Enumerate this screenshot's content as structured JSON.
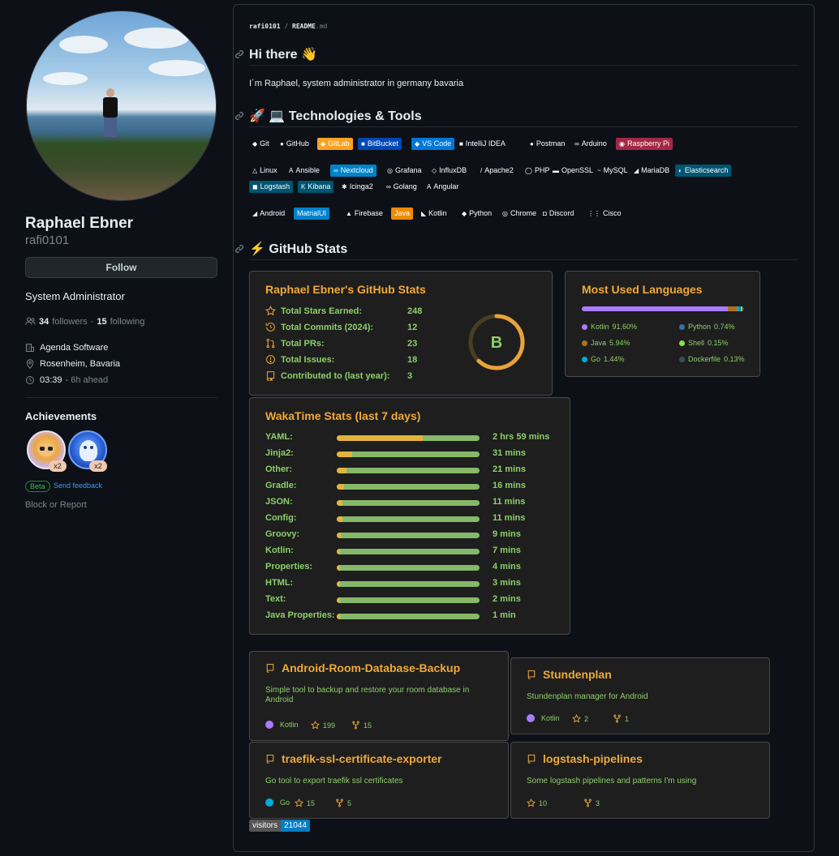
{
  "profile": {
    "name": "Raphael Ebner",
    "login": "rafi0101",
    "follow_label": "Follow",
    "bio": "System Administrator",
    "followers_count": "34",
    "followers_label": "followers",
    "separator": "·",
    "following_count": "15",
    "following_label": "following",
    "company": "Agenda Software",
    "location": "Rosenheim, Bavaria",
    "local_time": "03:39",
    "time_offset": "- 6h ahead",
    "achievements_title": "Achievements",
    "achievement_badges": [
      {
        "icon": "yolo-badge-icon",
        "multiplier": "x2"
      },
      {
        "icon": "pull-shark-badge-icon",
        "multiplier": "x2"
      }
    ],
    "beta_label": "Beta",
    "feedback_label": "Send feedback",
    "block_label": "Block or Report"
  },
  "readme": {
    "breadcrumb_user": "rafi0101",
    "breadcrumb_sep": "/",
    "breadcrumb_file": "README",
    "breadcrumb_ext": ".md",
    "heading_hi": "Hi there 👋",
    "intro": "I´m Raphael, system administrator in germany bavaria",
    "heading_tech": "🚀 💻 Technologies & Tools",
    "heading_stats": "⚡ GitHub Stats"
  },
  "tech_rows": [
    [
      {
        "label": "Git",
        "icon": "◆",
        "bg": "#0d1117"
      },
      {
        "label": "GitHub",
        "icon": "●",
        "bg": "#0d1117"
      },
      {
        "label": "GitLab",
        "icon": "◆",
        "bg": "#fca121"
      },
      {
        "label": "BitBucket",
        "icon": "■",
        "bg": "#0047b3"
      },
      {
        "label": "VS Code",
        "icon": "◆",
        "bg": "#0078d7"
      },
      {
        "label": "IntelliJ IDEA",
        "icon": "■",
        "bg": "#0d1117"
      },
      {
        "label": "Postman",
        "icon": "●",
        "bg": "#0d1117"
      },
      {
        "label": "Arduino",
        "icon": "∞",
        "bg": "#0d1117"
      },
      {
        "label": "Raspberry Pi",
        "icon": "◉",
        "bg": "#a22846"
      }
    ],
    [
      {
        "label": "Linux",
        "icon": "△",
        "bg": "#0d1117"
      },
      {
        "label": "Ansible",
        "icon": "A",
        "bg": "#0d1117"
      },
      {
        "label": "Nextcloud",
        "icon": "∞",
        "bg": "#0082c9"
      },
      {
        "label": "Grafana",
        "icon": "◎",
        "bg": "#0d1117"
      },
      {
        "label": "InfluxDB",
        "icon": "◇",
        "bg": "#0d1117"
      },
      {
        "label": "Apache2",
        "icon": "/",
        "bg": "#0d1117"
      },
      {
        "label": "PHP",
        "icon": "◯",
        "bg": "#0d1117"
      },
      {
        "label": "OpenSSL",
        "icon": "▬",
        "bg": "#0d1117"
      },
      {
        "label": "MySQL",
        "icon": "~",
        "bg": "#0d1117"
      },
      {
        "label": "MariaDB",
        "icon": "◢",
        "bg": "#0d1117"
      },
      {
        "label": "Elasticsearch",
        "icon": "◐",
        "bg": "#005571"
      }
    ],
    [
      {
        "label": "Logstash",
        "icon": "◼",
        "bg": "#005571"
      },
      {
        "label": "Kibana",
        "icon": "K",
        "bg": "#005571"
      },
      {
        "label": "Icinga2",
        "icon": "✱",
        "bg": "#0d1117"
      },
      {
        "label": "Golang",
        "icon": "∞",
        "bg": "#0d1117"
      },
      {
        "label": "Angular",
        "icon": "A",
        "bg": "#0d1117"
      }
    ],
    [
      {
        "label": "Android",
        "icon": "◢",
        "bg": "#0d1117"
      },
      {
        "label": "MatrialUI",
        "icon": "",
        "bg": "#0081cb"
      },
      {
        "label": "Firebase",
        "icon": "▲",
        "bg": "#0d1117"
      },
      {
        "label": "Java",
        "icon": "",
        "bg": "#ed8b00"
      },
      {
        "label": "Kotlin",
        "icon": "◣",
        "bg": "#0d1117"
      },
      {
        "label": "Python",
        "icon": "◆",
        "bg": "#0d1117"
      },
      {
        "label": "Chrome",
        "icon": "◎",
        "bg": "#0d1117"
      },
      {
        "label": "Discord",
        "icon": "◘",
        "bg": "#0d1117"
      },
      {
        "label": "Cisco",
        "icon": "⋮⋮",
        "bg": "#0d1117"
      }
    ]
  ],
  "github_stats": {
    "title": "Raphael Ebner's GitHub Stats",
    "rows": [
      {
        "icon": "star-icon",
        "label": "Total Stars Earned:",
        "value": "248"
      },
      {
        "icon": "history-icon",
        "label": "Total Commits (2024):",
        "value": "12"
      },
      {
        "icon": "pull-request-icon",
        "label": "Total PRs:",
        "value": "23"
      },
      {
        "icon": "issue-icon",
        "label": "Total Issues:",
        "value": "18"
      },
      {
        "icon": "repo-icon",
        "label": "Contributed to (last year):",
        "value": "3"
      }
    ],
    "rank": "B",
    "rank_progress": 0.62
  },
  "languages": {
    "title": "Most Used Languages",
    "items": [
      {
        "name": "Kotlin",
        "percent": "91.60%",
        "value": 91.6,
        "color": "#a97bff"
      },
      {
        "name": "Python",
        "percent": "0.74%",
        "value": 0.74,
        "color": "#3572a5"
      },
      {
        "name": "Java",
        "percent": "5.94%",
        "value": 5.94,
        "color": "#b07219"
      },
      {
        "name": "Shell",
        "percent": "0.15%",
        "value": 0.15,
        "color": "#89e051"
      },
      {
        "name": "Go",
        "percent": "1.44%",
        "value": 1.44,
        "color": "#00add8"
      },
      {
        "name": "Dockerfile",
        "percent": "0.13%",
        "value": 0.13,
        "color": "#384d54"
      }
    ]
  },
  "wakatime": {
    "title": "WakaTime Stats (last 7 days)",
    "rows": [
      {
        "label": "YAML:",
        "value": "2 hrs 59 mins",
        "fraction": 0.6
      },
      {
        "label": "Jinja2:",
        "value": "31 mins",
        "fraction": 0.11
      },
      {
        "label": "Other:",
        "value": "21 mins",
        "fraction": 0.07
      },
      {
        "label": "Gradle:",
        "value": "16 mins",
        "fraction": 0.05
      },
      {
        "label": "JSON:",
        "value": "11 mins",
        "fraction": 0.04
      },
      {
        "label": "Config:",
        "value": "11 mins",
        "fraction": 0.04
      },
      {
        "label": "Groovy:",
        "value": "9 mins",
        "fraction": 0.03
      },
      {
        "label": "Kotlin:",
        "value": "7 mins",
        "fraction": 0.025
      },
      {
        "label": "Properties:",
        "value": "4 mins",
        "fraction": 0.015
      },
      {
        "label": "HTML:",
        "value": "3 mins",
        "fraction": 0.012
      },
      {
        "label": "Text:",
        "value": "2 mins",
        "fraction": 0.01
      },
      {
        "label": "Java Properties:",
        "value": "1 min",
        "fraction": 0.008
      }
    ]
  },
  "repos": [
    {
      "name": "Android-Room-Database-Backup",
      "desc": "Simple tool to backup and restore your room database in Android",
      "lang": "Kotlin",
      "lang_color": "#a97bff",
      "stars": "199",
      "forks": "15"
    },
    {
      "name": "Stundenplan",
      "desc": "Stundenplan manager for Android",
      "lang": "Kotlin",
      "lang_color": "#a97bff",
      "stars": "2",
      "forks": "1"
    },
    {
      "name": "traefik-ssl-certificate-exporter",
      "desc": "Go tool to export traefik ssl certificates",
      "lang": "Go",
      "lang_color": "#00add8",
      "stars": "15",
      "forks": "5"
    },
    {
      "name": "logstash-pipelines",
      "desc": "Some logstash pipelines and patterns I'm using",
      "lang": "",
      "lang_color": "",
      "stars": "10",
      "forks": "3"
    }
  ],
  "visitors": {
    "label": "visitors",
    "count": "21044"
  }
}
